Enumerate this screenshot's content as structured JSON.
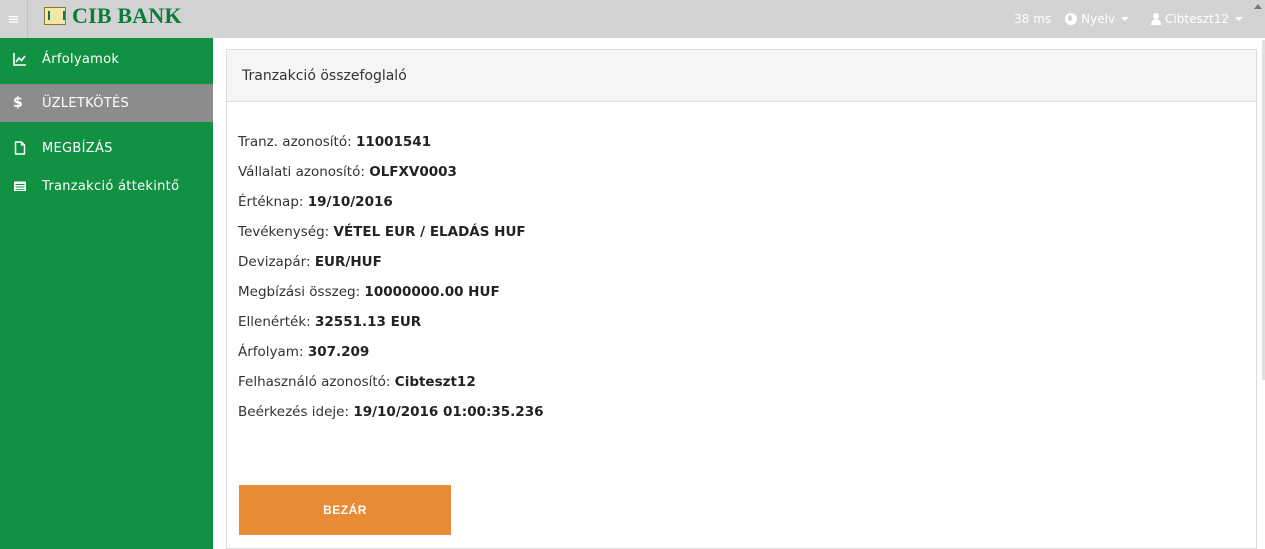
{
  "topbar": {
    "menu_icon": "hamburger-icon",
    "brand": "CIB BANK",
    "latency": "38 ms",
    "language_label": "Nyelv",
    "user_label": "Cibteszt12",
    "colors": {
      "bar": "#d3d3d3",
      "brand": "#0b7d3a"
    }
  },
  "sidebar": {
    "color": "#119142",
    "active_color": "#8c8c8c",
    "items": [
      {
        "label": "Árfolyamok",
        "icon": "line-chart-icon",
        "active": false
      },
      {
        "label": "ÜZLETKÖTÉS",
        "icon": "dollar-icon",
        "active": true
      },
      {
        "label": "MEGBÍZÁS",
        "icon": "file-icon",
        "active": false
      },
      {
        "label": "Tranzakció áttekintő",
        "icon": "list-icon",
        "active": false
      }
    ]
  },
  "panel": {
    "title": "Tranzakció összefoglaló",
    "rows": [
      {
        "label": "Tranz. azonosító:",
        "value": "11001541"
      },
      {
        "label": "Vállalati azonosító:",
        "value": "OLFXV0003"
      },
      {
        "label": "Értéknap:",
        "value": "19/10/2016"
      },
      {
        "label": "Tevékenység:",
        "value": "VÉTEL EUR / ELADÁS HUF"
      },
      {
        "label": "Devizapár:",
        "value": "EUR/HUF"
      },
      {
        "label": "Megbízási összeg:",
        "value": "10000000.00 HUF"
      },
      {
        "label": "Ellenérték:",
        "value": "32551.13 EUR"
      },
      {
        "label": "Árfolyam:",
        "value": "307.209"
      },
      {
        "label": "Felhasználó azonosító:",
        "value": "Cibteszt12"
      },
      {
        "label": "Beérkezés ideje:",
        "value": "19/10/2016 01:00:35.236"
      }
    ],
    "close_button": "BEZÁR",
    "close_color": "#e98a35"
  }
}
